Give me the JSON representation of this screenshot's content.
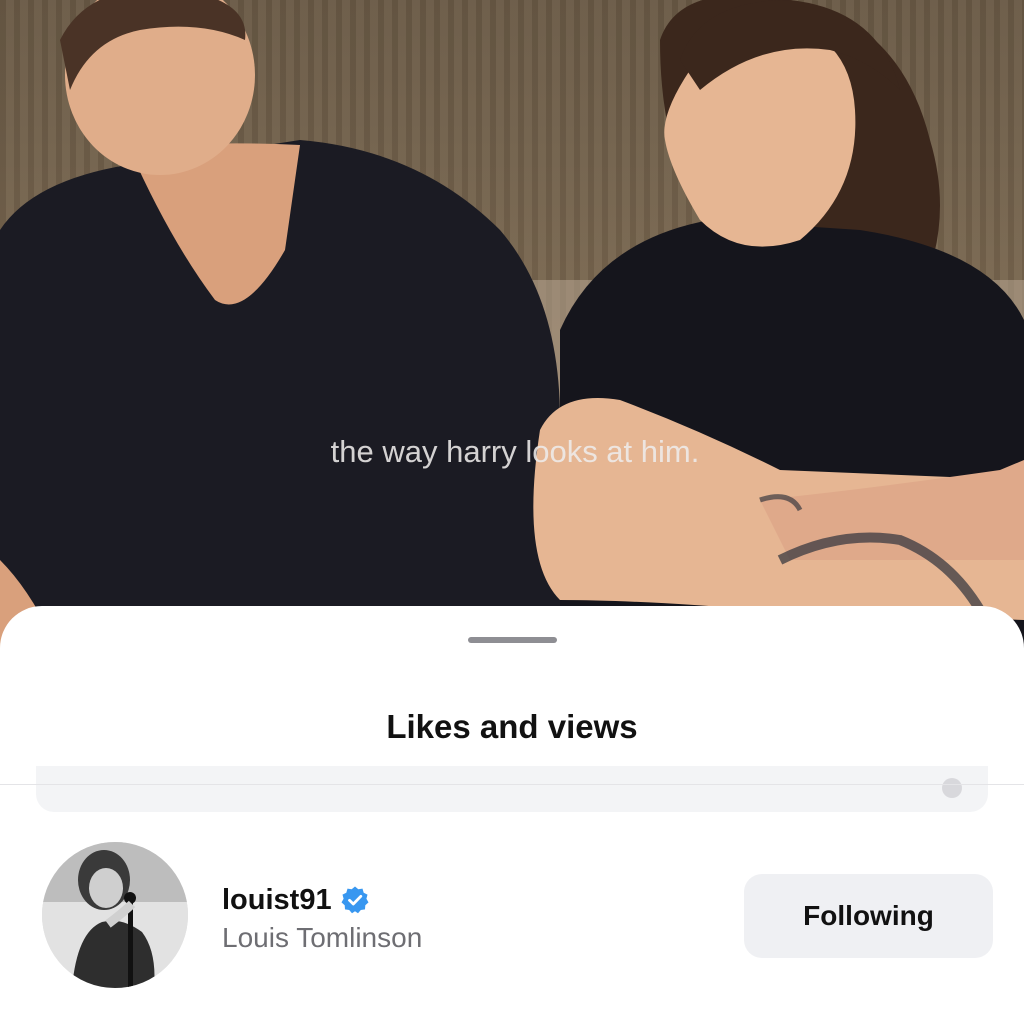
{
  "video": {
    "caption": "the way harry looks at him."
  },
  "sheet": {
    "title": "Likes and views"
  },
  "user": {
    "username": "louist91",
    "full_name": "Louis Tomlinson",
    "verified": true,
    "follow_button_label": "Following"
  },
  "icons": {
    "verified": "verified-badge-icon",
    "clear": "clear-icon"
  },
  "colors": {
    "verified_badge": "#3897f0",
    "button_background": "#eff0f3",
    "secondary_text": "#6e6e73"
  }
}
